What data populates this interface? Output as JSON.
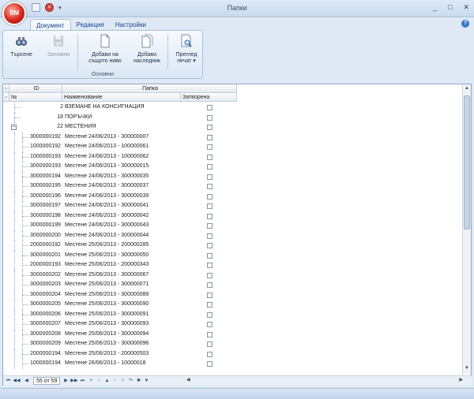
{
  "window": {
    "title": "Папки",
    "app_badge": "SM",
    "controls": [
      "_",
      "□",
      "✕"
    ],
    "help": "?"
  },
  "tabs": [
    {
      "label": "Документ",
      "active": true
    },
    {
      "label": "Редакция",
      "active": false
    },
    {
      "label": "Настройки",
      "active": false
    }
  ],
  "ribbon": {
    "group_label": "Основни",
    "search": "Търсене",
    "save": "Запомни",
    "add_same_level_1": "Добави на",
    "add_same_level_2": "същото ниво",
    "add_child_1": "Добави",
    "add_child_2": "наследник",
    "preview_1": "Преглед",
    "preview_2": "печат ▾"
  },
  "grid": {
    "band_id": "ID",
    "band_folder": "Папка",
    "col_no": "№",
    "col_name": "Наименование",
    "col_closed": "Затворена",
    "rows": [
      {
        "id": "2",
        "name": "ВЗЕМАНЕ НА КОНСИГНАЦИЯ",
        "level": 0
      },
      {
        "id": "18",
        "name": "ПОРЪЧКИ",
        "level": 0
      },
      {
        "id": "22",
        "name": "МЕСТЕНИЯ",
        "level": 0,
        "expanded": true
      },
      {
        "id": "3000000192",
        "name": "Местене 24/06/2013 - 300000007",
        "level": 1
      },
      {
        "id": "1000000192",
        "name": "Местене 24/06/2013 - 100000061",
        "level": 1
      },
      {
        "id": "1000000193",
        "name": "Местене 24/06/2013 - 100000062",
        "level": 1
      },
      {
        "id": "3000000193",
        "name": "Местене 24/06/2013 - 300000015",
        "level": 1
      },
      {
        "id": "3000000194",
        "name": "Местене 24/06/2013 - 300000035",
        "level": 1
      },
      {
        "id": "3000000195",
        "name": "Местене 24/06/2013 - 300000037",
        "level": 1
      },
      {
        "id": "3000000196",
        "name": "Местене 24/06/2013 - 300000039",
        "level": 1
      },
      {
        "id": "3000000197",
        "name": "Местене 24/06/2013 - 300000041",
        "level": 1
      },
      {
        "id": "3000000198",
        "name": "Местене 24/06/2013 - 300000042",
        "level": 1
      },
      {
        "id": "3000000199",
        "name": "Местене 24/06/2013 - 300000043",
        "level": 1
      },
      {
        "id": "3000000200",
        "name": "Местене 24/06/2013 - 300000044",
        "level": 1
      },
      {
        "id": "2000000192",
        "name": "Местене 25/06/2013 - 200000285",
        "level": 1
      },
      {
        "id": "3000000201",
        "name": "Местене 25/06/2013 - 300000050",
        "level": 1
      },
      {
        "id": "2000000193",
        "name": "Местене 25/06/2013 - 200000343",
        "level": 1
      },
      {
        "id": "3000000202",
        "name": "Местене 25/06/2013 - 300000067",
        "level": 1
      },
      {
        "id": "3000000203",
        "name": "Местене 25/06/2013 - 300000071",
        "level": 1
      },
      {
        "id": "3000000204",
        "name": "Местене 25/06/2013 - 300000089",
        "level": 1
      },
      {
        "id": "3000000205",
        "name": "Местене 25/06/2013 - 300000090",
        "level": 1
      },
      {
        "id": "3000000206",
        "name": "Местене 25/06/2013 - 300000091",
        "level": 1
      },
      {
        "id": "3000000207",
        "name": "Местене 25/06/2013 - 300000093",
        "level": 1
      },
      {
        "id": "3000000208",
        "name": "Местене 25/06/2013 - 300000094",
        "level": 1
      },
      {
        "id": "3000000209",
        "name": "Местене 25/06/2013 - 300000096",
        "level": 1
      },
      {
        "id": "2000000194",
        "name": "Местене 25/06/2013 - 200000503",
        "level": 1
      },
      {
        "id": "1000000194",
        "name": "Местене 26/06/2013 - 10000018",
        "level": 1
      }
    ]
  },
  "navigator": {
    "record": "55 от 59",
    "buttons": [
      "⏮",
      "◀◀",
      "◀",
      "▶",
      "▶▶",
      "⏭",
      "+",
      "−",
      "▲",
      "✓",
      "✕",
      "↷",
      "✱",
      "▼"
    ]
  }
}
